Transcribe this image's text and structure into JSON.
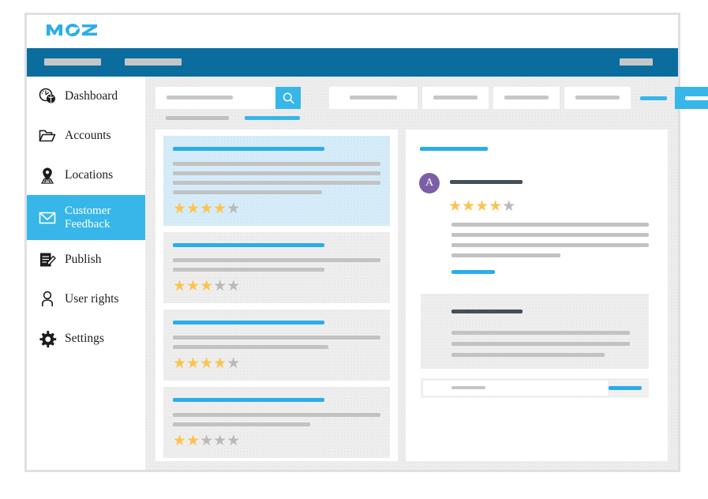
{
  "app": {
    "logo_text": "MOZ",
    "brand_color": "#2badea",
    "header_color": "#0b6d9e",
    "accent_color": "#37b6e9",
    "star_on_color": "#fcc350",
    "star_off_color": "#b9b9b9",
    "avatar_color": "#7a5fa8"
  },
  "topnav": {
    "items": [
      {
        "name": "nav-item-1",
        "label": ""
      },
      {
        "name": "nav-item-2",
        "label": ""
      }
    ],
    "account_label": ""
  },
  "sidebar": {
    "items": [
      {
        "label": "Dashboard",
        "icon": "dashboard-icon",
        "active": false
      },
      {
        "label": "Accounts",
        "icon": "folder-icon",
        "active": false
      },
      {
        "label": "Locations",
        "icon": "map-pin-icon",
        "active": false
      },
      {
        "label": "Customer Feedback",
        "icon": "envelope-icon",
        "active": true
      },
      {
        "label": "Publish",
        "icon": "edit-doc-icon",
        "active": false
      },
      {
        "label": "User rights",
        "icon": "user-icon",
        "active": false
      },
      {
        "label": "Settings",
        "icon": "gear-icon",
        "active": false
      }
    ]
  },
  "toolbar": {
    "search_placeholder": "",
    "search_value": "",
    "search_button_icon": "search-icon",
    "filters": [
      {
        "name": "filter-select-1",
        "value": ""
      },
      {
        "name": "filter-select-2",
        "value": ""
      },
      {
        "name": "filter-select-3",
        "value": ""
      },
      {
        "name": "filter-select-4",
        "value": ""
      }
    ],
    "link_label": "",
    "primary_button_label": ""
  },
  "tabs": [
    {
      "label": "",
      "active": false
    },
    {
      "label": "",
      "active": true
    }
  ],
  "list_panel": {
    "cards": [
      {
        "title": "",
        "lines": 4,
        "rating": 4,
        "selected": true
      },
      {
        "title": "",
        "lines": 2,
        "rating": 3,
        "selected": false
      },
      {
        "title": "",
        "lines": 2,
        "rating": 4,
        "selected": false
      },
      {
        "title": "",
        "lines": 2,
        "rating": 2,
        "selected": false
      }
    ]
  },
  "detail_panel": {
    "heading_label": "",
    "avatar_initial": "A",
    "author_label": "",
    "rating": 4,
    "body_lines": 4,
    "reply_link_label": "",
    "reply": {
      "author_label": "",
      "body_lines": 3
    },
    "reply_form": {
      "input_placeholder": "",
      "submit_label": ""
    }
  },
  "rating_max": 5
}
